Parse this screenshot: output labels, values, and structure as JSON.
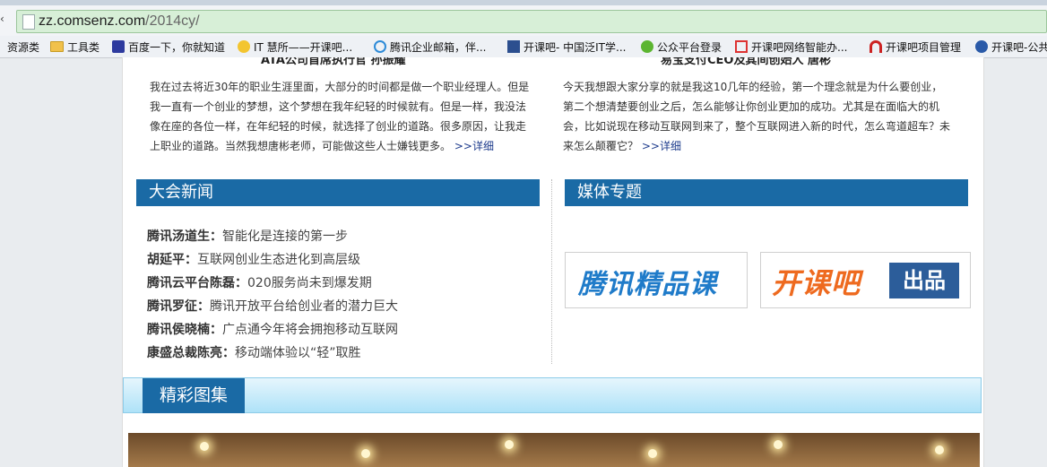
{
  "browser": {
    "url_host": "zz.comsenz.com",
    "url_path": "/2014cy/",
    "bookmarks": [
      {
        "label": "资源类",
        "icon": "folder-icon"
      },
      {
        "label": "工具类",
        "icon": "folder-icon"
      },
      {
        "label": "百度一下，你就知道",
        "icon": "baidu-paw-icon"
      },
      {
        "label": "IT 慧所——开课吧...",
        "icon": "bulb-icon"
      },
      {
        "label": "腾讯企业邮箱，伴...",
        "icon": "qq-mail-icon"
      },
      {
        "label": "开课吧- 中国泛IT学...",
        "icon": "book-icon"
      },
      {
        "label": "公众平台登录",
        "icon": "wechat-icon"
      },
      {
        "label": "开课吧网络智能办...",
        "icon": "office-icon"
      },
      {
        "label": "开课吧项目管理",
        "icon": "arch-icon"
      },
      {
        "label": "开课吧-公共",
        "icon": "person-icon"
      }
    ]
  },
  "speeches": [
    {
      "title": "ATA公司首席执行官 孙振耀",
      "text": "我在过去将近30年的职业生涯里面，大部分的时间都是做一个职业经理人。但是我一直有一个创业的梦想，这个梦想在我年纪轻的时候就有。但是一样，我没法像在座的各位一样，在年纪轻的时候，就选择了创业的道路。很多原因，让我走上职业的道路。当然我想唐彬老师，可能做这些人士嫌钱更多。",
      "more": ">>详细"
    },
    {
      "title": "易宝支付CEO及其间创始人 唐彬",
      "text": "今天我想跟大家分享的就是我这10几年的经验，第一个理念就是为什么要创业，第二个想清楚要创业之后，怎么能够让你创业更加的成功。尤其是在面临大的机会，比如说现在移动互联网到来了，整个互联网进入新的时代，怎么弯道超车？未来怎么颠覆它？",
      "more": ">>详细"
    }
  ],
  "sections": {
    "news_title": "大会新闻",
    "media_title": "媒体专题",
    "gallery_title": "精彩图集"
  },
  "news": [
    {
      "name": "腾讯汤道生：",
      "headline": "智能化是连接的第一步"
    },
    {
      "name": "胡延平：",
      "headline": "互联网创业生态进化到高层级"
    },
    {
      "name": "腾讯云平台陈磊：",
      "headline": "020服务尚未到爆发期"
    },
    {
      "name": "腾讯罗征：",
      "headline": "腾讯开放平台给创业者的潜力巨大"
    },
    {
      "name": "腾讯侯晓楠：",
      "headline": "广点通今年将会拥抱移动互联网"
    },
    {
      "name": "康盛总裁陈亮：",
      "headline": "移动端体验以“轻”取胜"
    }
  ],
  "media": {
    "logo1": "腾讯精品课",
    "logo2_main": "开课吧",
    "logo2_badge": "出品"
  },
  "colors": {
    "section_bar": "#1a6aa5",
    "logo_blue": "#1f7bc9",
    "logo_orange": "#ee6a1f"
  }
}
